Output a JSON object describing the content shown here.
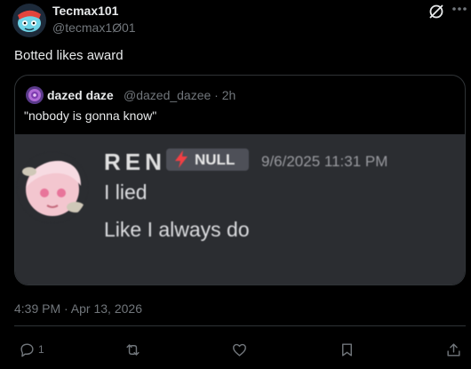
{
  "post": {
    "author_name": "Tecmax101",
    "author_handle": "@tecmax1Ø01",
    "text": "Botted likes award",
    "timestamp": "4:39 PM · Apr 13, 2026"
  },
  "quote": {
    "author_name": "dazed daze",
    "author_handle": "@dazed_dazee · 2h",
    "text": "\"nobody is gonna know\""
  },
  "media": {
    "username": "REN",
    "tag": "NULL",
    "timestamp": "9/6/2025 11:31 PM",
    "lines": [
      "I lied",
      "Like I always do"
    ]
  },
  "actions": {
    "reply_count": "1"
  },
  "icons": [
    "grok-icon",
    "more-icon",
    "reply-icon",
    "repost-icon",
    "like-icon",
    "bookmark-icon",
    "share-icon"
  ],
  "colors": {
    "background": "#000000",
    "text": "#e7e9ea",
    "muted": "#71767b",
    "border": "#2f3336",
    "media_bg": "#2b2d31",
    "tag_accent": "#f23f43"
  }
}
